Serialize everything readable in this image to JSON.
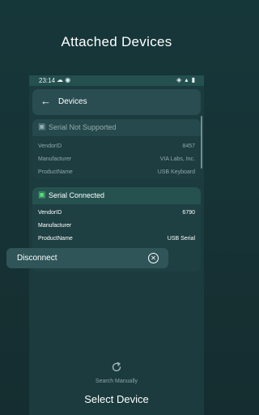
{
  "headline": "Attached Devices",
  "status_bar": {
    "time": "23:14",
    "left_icons": "☁ ◉",
    "right_icons": "◈ ▴ ▮"
  },
  "app_bar": {
    "back_icon": "arrow-left-icon",
    "title": "Devices"
  },
  "devices": [
    {
      "status": "Serial Not Supported",
      "status_icon": "device-icon",
      "status_color": "#93aeb0",
      "rows": [
        {
          "key": "VendorID",
          "value": "8457"
        },
        {
          "key": "Manufacturer",
          "value": "VIA Labs, Inc."
        },
        {
          "key": "ProductName",
          "value": "USB Keyboard"
        }
      ]
    },
    {
      "status": "Serial Connected",
      "status_icon": "device-icon",
      "status_color": "#5ad77a",
      "rows": [
        {
          "key": "VendorID",
          "value": "6790"
        },
        {
          "key": "Manufacturer",
          "value": ""
        },
        {
          "key": "ProductName",
          "value": "USB Serial"
        }
      ],
      "action": {
        "label": "Disconnect",
        "icon": "close-circle-icon"
      }
    }
  ],
  "search": {
    "label": "Search Manually",
    "icon": "refresh-icon"
  },
  "bottom_title": "Select Device",
  "colors": {
    "background": "#16373a",
    "card": "#1f4043",
    "connected": "#5ad77a"
  }
}
